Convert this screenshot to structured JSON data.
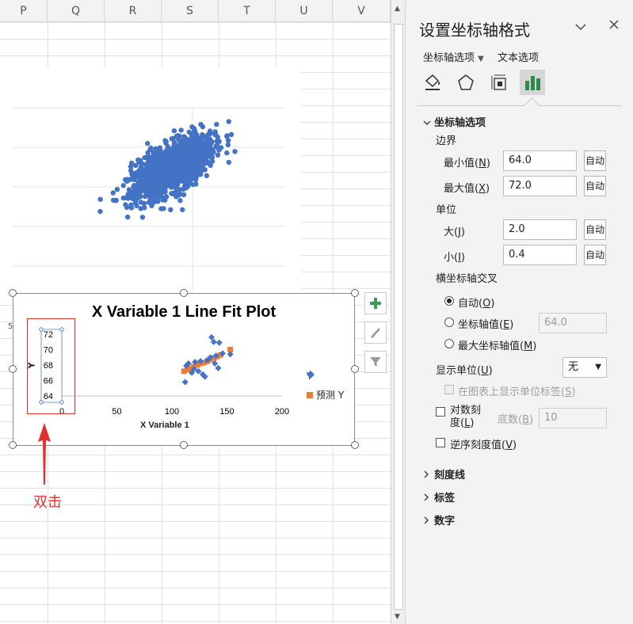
{
  "sheet": {
    "columns": [
      "P",
      "Q",
      "R",
      "S",
      "T",
      "U",
      "V"
    ],
    "row_stub_label": "5"
  },
  "chart_data": [
    {
      "type": "scatter",
      "title": "",
      "note": "Dense elliptical cloud of points, no axes or labels visible in this portion",
      "series": [
        {
          "color": "#4472c4"
        }
      ]
    },
    {
      "type": "scatter",
      "title": "X Variable 1 Line Fit  Plot",
      "xlabel": "X Variable 1",
      "ylabel": "Y",
      "xlim": [
        0,
        200
      ],
      "ylim": [
        64,
        72
      ],
      "x_ticks": [
        "0",
        "50",
        "100",
        "150",
        "200"
      ],
      "y_ticks": [
        "64",
        "66",
        "68",
        "70",
        "72"
      ],
      "legend_position": "right",
      "series": [
        {
          "name": "Y",
          "color": "#4472c4",
          "marker": "diamond",
          "points": [
            [
              112,
              65.8
            ],
            [
              113,
              67.9
            ],
            [
              115,
              68.2
            ],
            [
              118,
              67.0
            ],
            [
              120,
              67.5
            ],
            [
              121,
              68.4
            ],
            [
              124,
              67.2
            ],
            [
              126,
              68.5
            ],
            [
              128,
              66.8
            ],
            [
              130,
              66.5
            ],
            [
              132,
              68.6
            ],
            [
              135,
              69.0
            ],
            [
              136,
              71.6
            ],
            [
              138,
              71.0
            ],
            [
              139,
              68.2
            ],
            [
              140,
              69.2
            ],
            [
              142,
              67.6
            ],
            [
              143,
              70.9
            ],
            [
              146,
              69.5
            ],
            [
              153,
              69.4
            ]
          ]
        },
        {
          "name": "预测 Y",
          "color": "#ed7d31",
          "marker": "square",
          "points": [
            [
              111,
              67.2
            ],
            [
              114,
              67.4
            ],
            [
              117,
              67.6
            ],
            [
              120,
              67.8
            ],
            [
              123,
              68.0
            ],
            [
              126,
              68.2
            ],
            [
              129,
              68.3
            ],
            [
              132,
              68.5
            ],
            [
              135,
              68.7
            ],
            [
              138,
              68.9
            ],
            [
              141,
              69.1
            ],
            [
              144,
              69.3
            ],
            [
              153,
              70.0
            ]
          ]
        }
      ]
    }
  ],
  "annotation": {
    "text": "双击",
    "color": "#e03030"
  },
  "chart_buttons": [
    "plus-icon",
    "brush-icon",
    "filter-icon"
  ],
  "panel": {
    "title": "设置坐标轴格式",
    "tabs": {
      "axis_options": "坐标轴选项",
      "text_options": "文本选项"
    },
    "section_axis": "坐标轴选项",
    "bounds_label": "边界",
    "min_label": "最小值(",
    "min_key": "N",
    "max_label": "最大值(",
    "max_key": "X",
    "min_value": "64.0",
    "max_value": "72.0",
    "auto": "自动",
    "units_label": "单位",
    "major_label": "大(",
    "major_key": "J",
    "minor_label": "小(",
    "minor_key": "I",
    "major_value": "2.0",
    "minor_value": "0.4",
    "cross_label": "横坐标轴交叉",
    "cross_auto": "自动(",
    "cross_auto_key": "O",
    "cross_value_label": "坐标轴值(",
    "cross_value_key": "E",
    "cross_value": "64.0",
    "cross_max_label": "最大坐标轴值(",
    "cross_max_key": "M",
    "display_units_label": "显示单位(",
    "display_units_key": "U",
    "display_units_value": "无",
    "show_units_label": "在图表上显示单位标签(",
    "show_units_key": "S",
    "log_label_1": "对数刻",
    "log_label_2": "度(",
    "log_key": "L",
    "base_label": "底数(",
    "base_key": "B",
    "base_value": "10",
    "reverse_label": "逆序刻度值(",
    "reverse_key": "V",
    "sections_collapsed": [
      "刻度线",
      "标签",
      "数字"
    ]
  }
}
